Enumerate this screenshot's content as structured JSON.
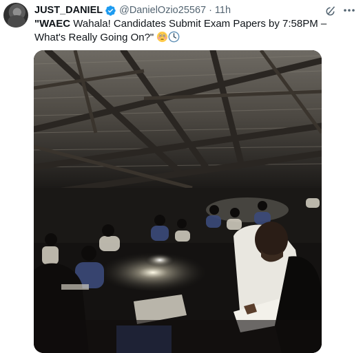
{
  "tweet": {
    "author_name": "JUST_DANIEL",
    "handle": "@DanielOzio25567",
    "separator": "·",
    "time": "11h",
    "text_bold": "\"WAEC",
    "text_rest": " Wahala! Candidates Submit Exam Papers by 7:58PM – What's Really Going On?\"",
    "emojis": [
      "flushed-face",
      "clock"
    ]
  },
  "icons": {
    "verified": "verified-badge-icon",
    "grok": "grok-icon",
    "more": "more-icon"
  },
  "colors": {
    "verified": "#1d9bf0",
    "secondary_text": "#536471",
    "primary_text": "#0f1419"
  }
}
